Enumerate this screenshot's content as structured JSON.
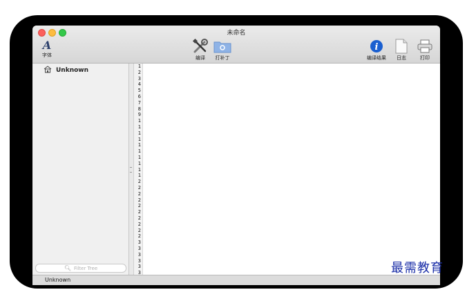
{
  "window": {
    "title": "未命名"
  },
  "toolbar": {
    "font_label": "字体",
    "font_glyph": "A",
    "compile_label": "编译",
    "patch_label": "打补丁",
    "results_label": "编译结果",
    "log_label": "日志",
    "print_label": "打印"
  },
  "sidebar": {
    "items": [
      {
        "label": "Unknown",
        "icon": "home-icon"
      }
    ],
    "filter_placeholder": "Filter Tree"
  },
  "editor": {
    "line_numbers": [
      "1",
      "2",
      "3",
      "4",
      "5",
      "6",
      "7",
      "8",
      "9",
      "1",
      "1",
      "1",
      "1",
      "1",
      "1",
      "1",
      "1",
      "1",
      "1",
      "2",
      "2",
      "2",
      "2",
      "2",
      "2",
      "2",
      "2",
      "2",
      "2",
      "3",
      "3",
      "3",
      "3",
      "3",
      "3"
    ],
    "content": ""
  },
  "status": {
    "text": "Unknown"
  },
  "watermark": "最需教育",
  "colors": {
    "accent": "#1a5fd0",
    "close": "#fc605c",
    "minimize": "#fdbc40",
    "maximize": "#34c84a"
  }
}
